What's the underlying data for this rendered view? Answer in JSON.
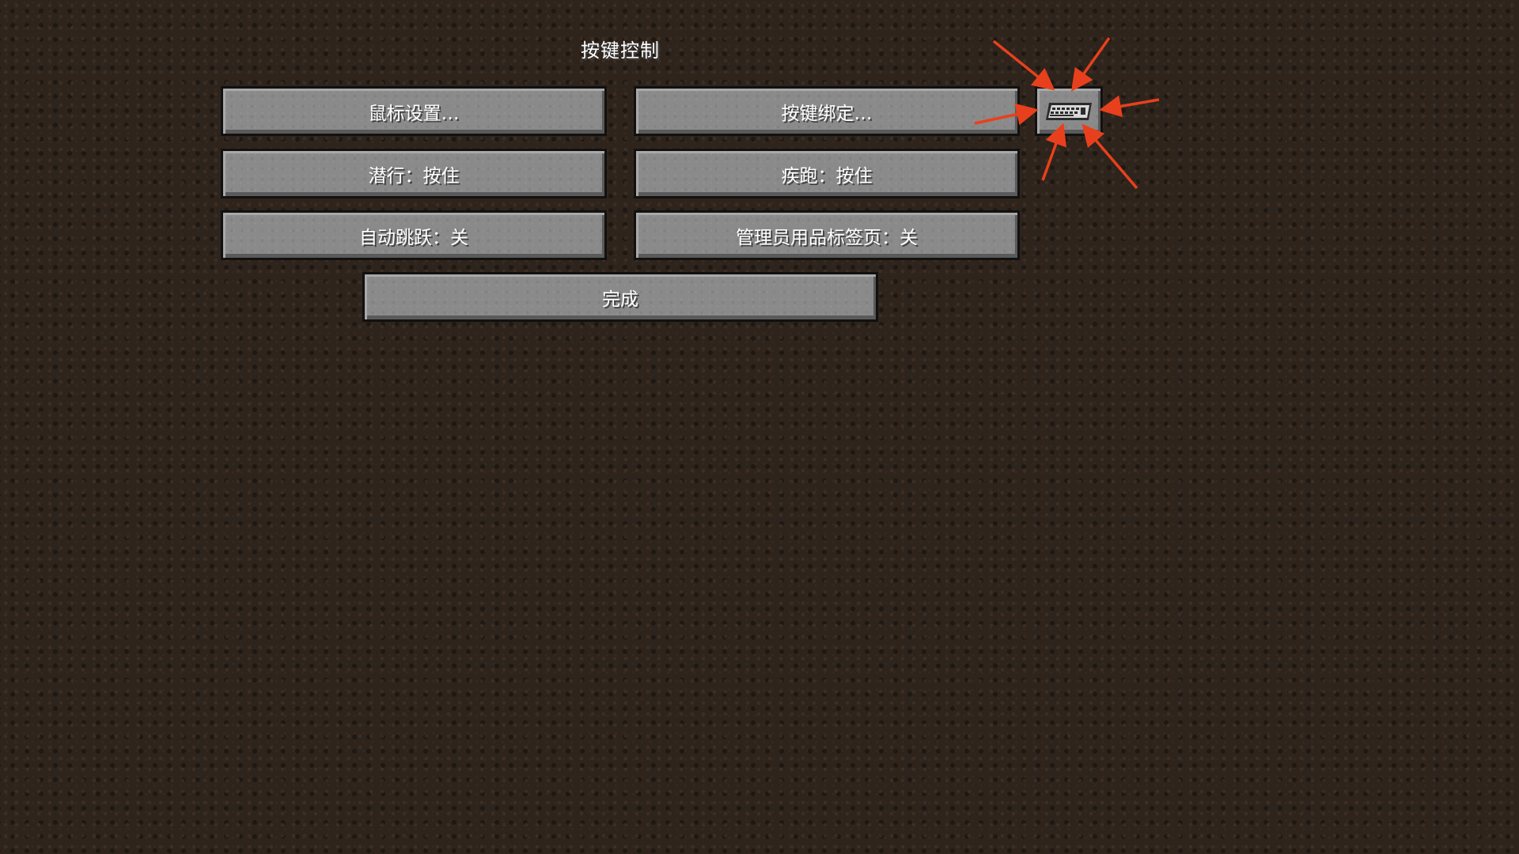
{
  "screen": {
    "title": "按键控制"
  },
  "buttons": {
    "mouse_settings": "鼠标设置…",
    "key_binds": "按键绑定…",
    "sneak": "潜行：按住",
    "sprint": "疾跑：按住",
    "auto_jump": "自动跳跃：关",
    "operator_items_tab": "管理员用品标签页：关",
    "done": "完成"
  },
  "keyboard_button": {
    "icon": "keyboard-icon"
  },
  "annotation": {
    "color": "#e8401c",
    "arrow_count": 6
  }
}
